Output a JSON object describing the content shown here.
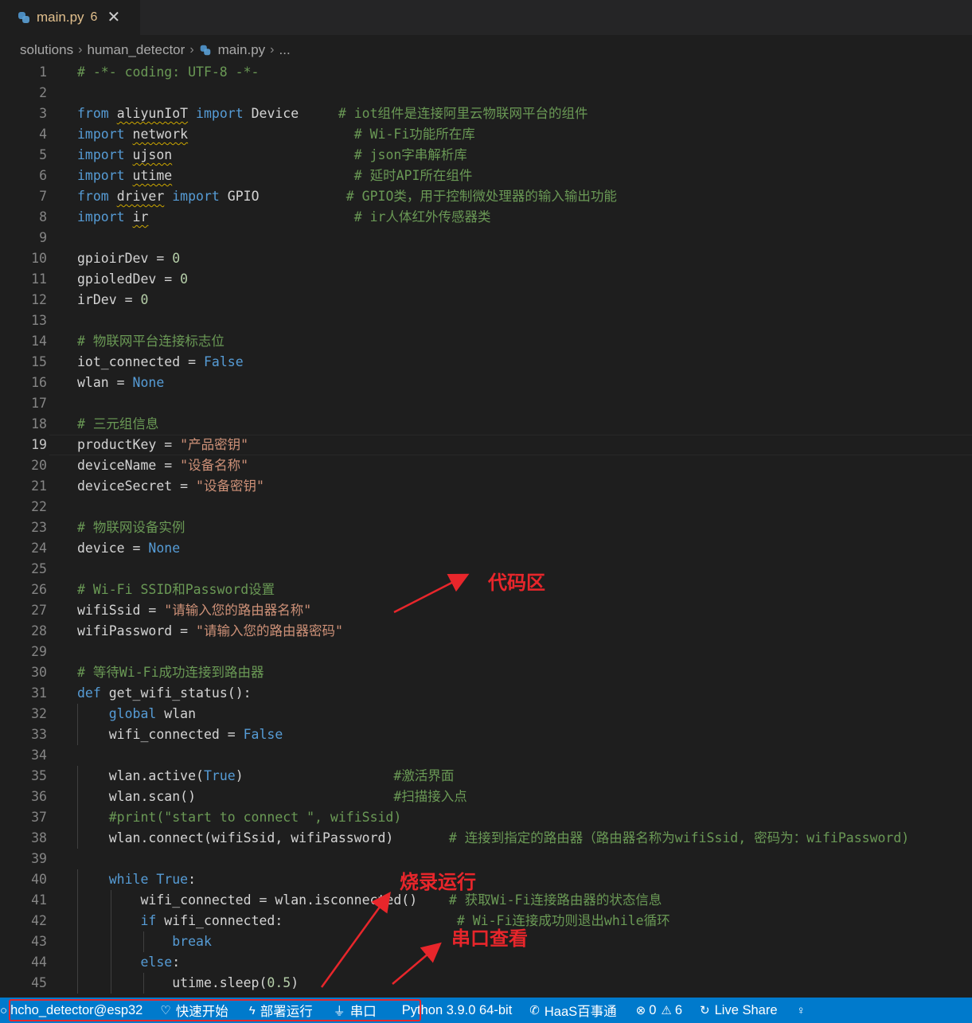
{
  "tab": {
    "title": "main.py",
    "badge": "6",
    "close_glyph": "✕",
    "icon": "python-icon"
  },
  "breadcrumb": {
    "items": [
      "solutions",
      "human_detector",
      "main.py",
      "..."
    ]
  },
  "editor": {
    "active_line": 19
  },
  "lines": [
    [
      {
        "t": "# -*- coding: UTF-8 -*-",
        "c": "com"
      }
    ],
    [],
    [
      {
        "t": "from",
        "c": "kw"
      },
      {
        "t": " "
      },
      {
        "t": "aliyunIoT",
        "c": "id squig"
      },
      {
        "t": " "
      },
      {
        "t": "import",
        "c": "kw"
      },
      {
        "t": " Device     "
      },
      {
        "t": "# iot组件是连接阿里云物联网平台的组件",
        "c": "com"
      }
    ],
    [
      {
        "t": "import",
        "c": "kw"
      },
      {
        "t": " "
      },
      {
        "t": "network",
        "c": "id squig"
      },
      {
        "t": "                     "
      },
      {
        "t": "# Wi-Fi功能所在库",
        "c": "com"
      }
    ],
    [
      {
        "t": "import",
        "c": "kw"
      },
      {
        "t": " "
      },
      {
        "t": "ujson",
        "c": "id squig"
      },
      {
        "t": "                       "
      },
      {
        "t": "# json字串解析库",
        "c": "com"
      }
    ],
    [
      {
        "t": "import",
        "c": "kw"
      },
      {
        "t": " "
      },
      {
        "t": "utime",
        "c": "id squig"
      },
      {
        "t": "                       "
      },
      {
        "t": "# 延时API所在组件",
        "c": "com"
      }
    ],
    [
      {
        "t": "from",
        "c": "kw"
      },
      {
        "t": " "
      },
      {
        "t": "driver",
        "c": "id squig"
      },
      {
        "t": " "
      },
      {
        "t": "import",
        "c": "kw"
      },
      {
        "t": " GPIO           "
      },
      {
        "t": "# GPIO类，用于控制微处理器的输入输出功能",
        "c": "com"
      }
    ],
    [
      {
        "t": "import",
        "c": "kw"
      },
      {
        "t": " "
      },
      {
        "t": "ir",
        "c": "id squig"
      },
      {
        "t": "                          "
      },
      {
        "t": "# ir人体红外传感器类",
        "c": "com"
      }
    ],
    [],
    [
      {
        "t": "gpioirDev = "
      },
      {
        "t": "0",
        "c": "num"
      }
    ],
    [
      {
        "t": "gpioledDev = "
      },
      {
        "t": "0",
        "c": "num"
      }
    ],
    [
      {
        "t": "irDev = "
      },
      {
        "t": "0",
        "c": "num"
      }
    ],
    [],
    [
      {
        "t": "# 物联网平台连接标志位",
        "c": "com"
      }
    ],
    [
      {
        "t": "iot_connected = "
      },
      {
        "t": "False",
        "c": "kw"
      }
    ],
    [
      {
        "t": "wlan = "
      },
      {
        "t": "None",
        "c": "kw"
      }
    ],
    [],
    [
      {
        "t": "# 三元组信息",
        "c": "com"
      }
    ],
    [
      {
        "t": "productKey = "
      },
      {
        "t": "\"产品密钥\"",
        "c": "str"
      }
    ],
    [
      {
        "t": "deviceName = "
      },
      {
        "t": "\"设备名称\"",
        "c": "str"
      }
    ],
    [
      {
        "t": "deviceSecret = "
      },
      {
        "t": "\"设备密钥\"",
        "c": "str"
      }
    ],
    [],
    [
      {
        "t": "# 物联网设备实例",
        "c": "com"
      }
    ],
    [
      {
        "t": "device = "
      },
      {
        "t": "None",
        "c": "kw"
      }
    ],
    [],
    [
      {
        "t": "# Wi-Fi SSID和Password设置",
        "c": "com"
      }
    ],
    [
      {
        "t": "wifiSsid = "
      },
      {
        "t": "\"请输入您的路由器名称\"",
        "c": "str"
      }
    ],
    [
      {
        "t": "wifiPassword = "
      },
      {
        "t": "\"请输入您的路由器密码\"",
        "c": "str"
      }
    ],
    [],
    [
      {
        "t": "# 等待Wi-Fi成功连接到路由器",
        "c": "com"
      }
    ],
    [
      {
        "t": "def",
        "c": "kw"
      },
      {
        "t": " get_wifi_status():"
      }
    ],
    [
      {
        "t": "    "
      },
      {
        "t": "global",
        "c": "kw"
      },
      {
        "t": " wlan"
      }
    ],
    [
      {
        "t": "    wifi_connected = "
      },
      {
        "t": "False",
        "c": "kw"
      }
    ],
    [],
    [
      {
        "t": "    wlan.active("
      },
      {
        "t": "True",
        "c": "kw"
      },
      {
        "t": ")                   "
      },
      {
        "t": "#激活界面",
        "c": "com"
      }
    ],
    [
      {
        "t": "    wlan.scan()                         "
      },
      {
        "t": "#扫描接入点",
        "c": "com"
      }
    ],
    [
      {
        "t": "    "
      },
      {
        "t": "#print(\"start to connect \", wifiSsid)",
        "c": "com"
      }
    ],
    [
      {
        "t": "    wlan.connect(wifiSsid, wifiPassword)       "
      },
      {
        "t": "# 连接到指定的路由器（路由器名称为wifiSsid, 密码为：wifiPassword)",
        "c": "com"
      }
    ],
    [],
    [
      {
        "t": "    "
      },
      {
        "t": "while",
        "c": "kw"
      },
      {
        "t": " "
      },
      {
        "t": "True",
        "c": "kw"
      },
      {
        "t": ":"
      }
    ],
    [
      {
        "t": "        wifi_connected = wlan.isconnected()    "
      },
      {
        "t": "# 获取Wi-Fi连接路由器的状态信息",
        "c": "com"
      }
    ],
    [
      {
        "t": "        "
      },
      {
        "t": "if",
        "c": "kw"
      },
      {
        "t": " wifi_connected:                      "
      },
      {
        "t": "# Wi-Fi连接成功则退出while循环",
        "c": "com"
      }
    ],
    [
      {
        "t": "            "
      },
      {
        "t": "break",
        "c": "kw"
      }
    ],
    [
      {
        "t": "        "
      },
      {
        "t": "else",
        "c": "kw"
      },
      {
        "t": ":"
      }
    ],
    [
      {
        "t": "            utime.sleep("
      },
      {
        "t": "0.5",
        "c": "num"
      },
      {
        "t": ")"
      }
    ]
  ],
  "annotations": {
    "code_area": "代码区",
    "flash_run": "烧录运行",
    "serial_view": "串口查看"
  },
  "statusbar": {
    "project": "hcho_detector@esp32",
    "quick_start": "快速开始",
    "deploy_run": "部署运行",
    "serial": "串口",
    "python": "Python 3.9.0 64-bit",
    "haas": "HaaS百事通",
    "errors": "0",
    "warnings": "6",
    "live_share": "Live Share"
  },
  "colors": {
    "statusbar": "#007acc",
    "annotation": "#e8262b",
    "editor_bg": "#1e1e1e"
  }
}
